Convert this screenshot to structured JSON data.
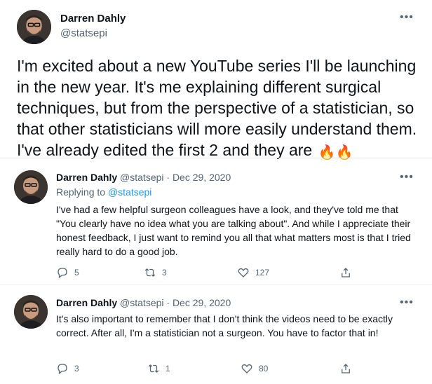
{
  "main_tweet": {
    "author_name": "Darren Dahly",
    "author_handle": "@statsepi",
    "text": "I'm excited about a new YouTube series I'll be launching in the new year. It's me explaining different surgical techniques, but from the perspective of a statistician, so that other statisticians will more easily understand them. I've already edited the first 2 and they are",
    "emoji": "🔥🔥"
  },
  "replies": [
    {
      "author_name": "Darren Dahly",
      "meta": "@statsepi · Dec 29, 2020",
      "replying_label": "Replying to",
      "replying_handle": "@statsepi",
      "text": "I've had a few helpful surgeon colleagues have a look, and they've told me that \"You clearly have no idea what you are talking about\". And while I appreciate their honest feedback, I just want to remind you all that what matters most is that I tried really hard to do a good job.",
      "reply_count": "5",
      "retweet_count": "3",
      "like_count": "127"
    },
    {
      "author_name": "Darren Dahly",
      "meta": "@statsepi · Dec 29, 2020",
      "text": "It's also important to remember that I don't think the videos need to be exactly correct. After all, I'm a statistician not a surgeon. You have to factor that in!",
      "reply_count": "3",
      "retweet_count": "1",
      "like_count": "80"
    }
  ],
  "icons": {
    "more": "more-horizontal-icon",
    "reply": "reply-icon",
    "retweet": "retweet-icon",
    "like": "heart-icon",
    "share": "share-icon"
  },
  "colors": {
    "text": "#0f1419",
    "secondary": "#536471",
    "link": "#1d9bf0"
  }
}
